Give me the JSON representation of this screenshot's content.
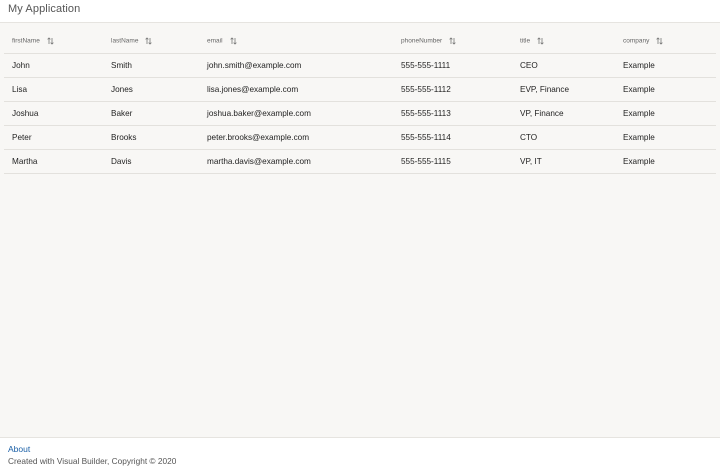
{
  "app": {
    "title": "My Application"
  },
  "table": {
    "columns": [
      {
        "key": "firstName",
        "label": "firstName"
      },
      {
        "key": "lastName",
        "label": "lastName"
      },
      {
        "key": "email",
        "label": "email"
      },
      {
        "key": "phoneNumber",
        "label": "phoneNumber"
      },
      {
        "key": "title",
        "label": "title"
      },
      {
        "key": "company",
        "label": "company"
      }
    ],
    "rows": [
      {
        "firstName": "John",
        "lastName": "Smith",
        "email": "john.smith@example.com",
        "phoneNumber": "555-555-1111",
        "title": "CEO",
        "company": "Example"
      },
      {
        "firstName": "Lisa",
        "lastName": "Jones",
        "email": "lisa.jones@example.com",
        "phoneNumber": "555-555-1112",
        "title": "EVP, Finance",
        "company": "Example"
      },
      {
        "firstName": "Joshua",
        "lastName": "Baker",
        "email": "joshua.baker@example.com",
        "phoneNumber": "555-555-1113",
        "title": "VP, Finance",
        "company": "Example"
      },
      {
        "firstName": "Peter",
        "lastName": "Brooks",
        "email": "peter.brooks@example.com",
        "phoneNumber": "555-555-1114",
        "title": "CTO",
        "company": "Example"
      },
      {
        "firstName": "Martha",
        "lastName": "Davis",
        "email": "martha.davis@example.com",
        "phoneNumber": "555-555-1115",
        "title": "VP, IT",
        "company": "Example"
      }
    ]
  },
  "footer": {
    "about_label": "About",
    "copyright": "Created with Visual Builder, Copyright © 2020"
  },
  "icons": {
    "sort": "sort-arrows-icon"
  },
  "colors": {
    "link": "#1a5fa6",
    "content_bg": "#f8f7f5",
    "divider": "#e3e1dd"
  }
}
